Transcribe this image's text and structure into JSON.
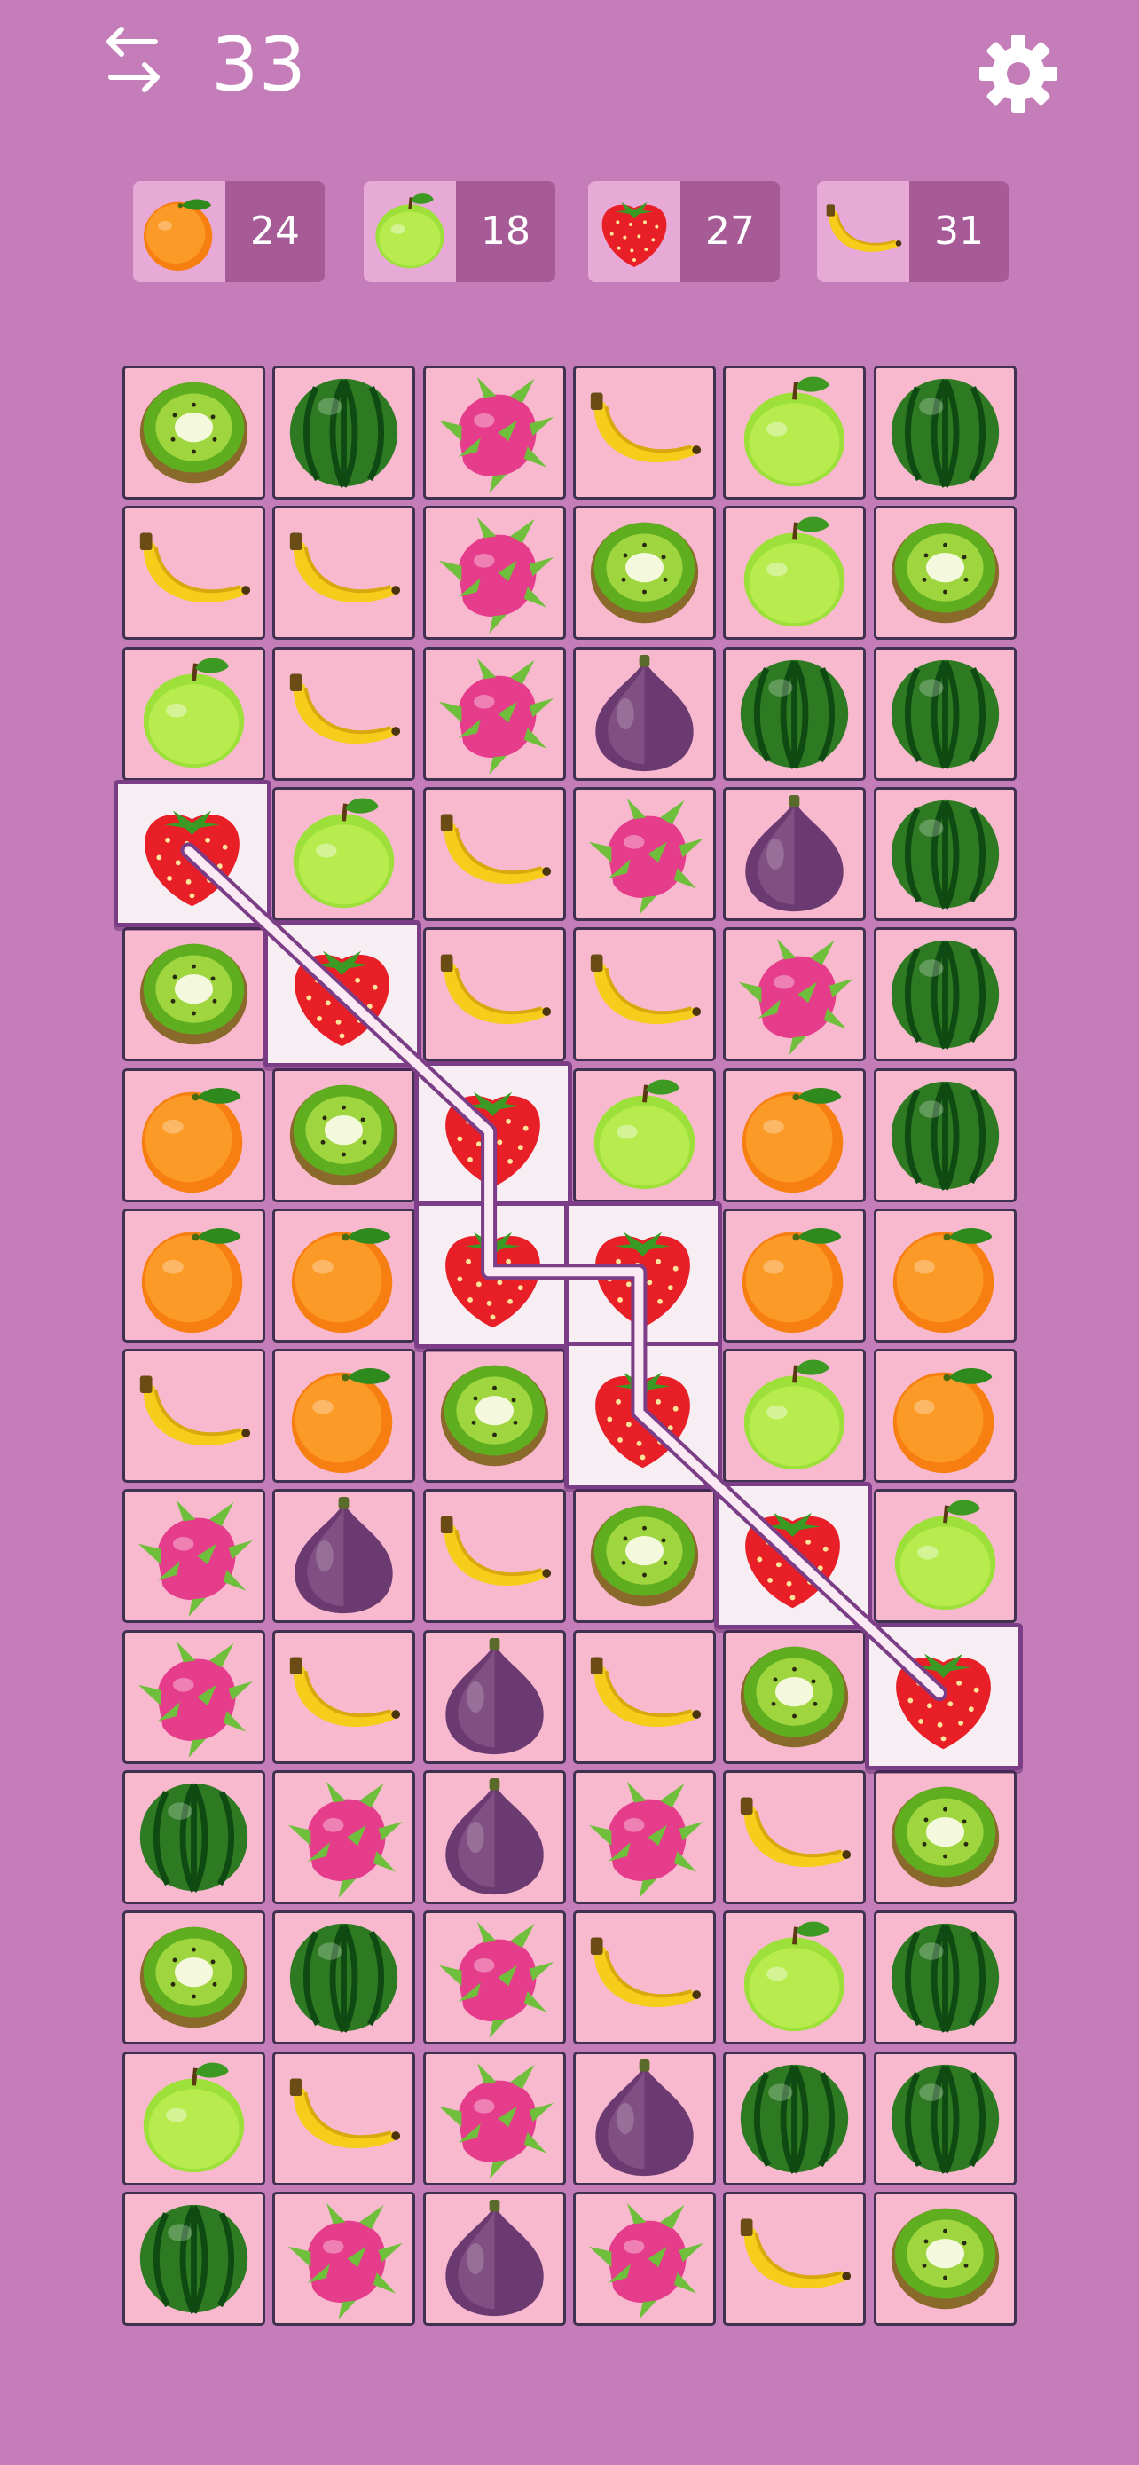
{
  "header": {
    "moves": "33"
  },
  "goals": [
    {
      "fruit": "orange",
      "count": "24"
    },
    {
      "fruit": "apple",
      "count": "18"
    },
    {
      "fruit": "strawberry",
      "count": "27"
    },
    {
      "fruit": "banana",
      "count": "31"
    }
  ],
  "icons": {
    "undo": "swap-arrows-icon",
    "settings": "gear-icon"
  },
  "colors": {
    "background": "#c47db9",
    "tile": "#f8b9cf",
    "tile_border": "#3f3150",
    "selected": "#7b3d86"
  },
  "board": {
    "columns": 6,
    "rows": 14,
    "grid": [
      [
        "kiwi",
        "watermelon",
        "dragonfruit",
        "banana",
        "apple",
        "watermelon"
      ],
      [
        "banana",
        "banana",
        "dragonfruit",
        "kiwi",
        "apple",
        "kiwi"
      ],
      [
        "apple",
        "banana",
        "dragonfruit",
        "fig",
        "watermelon",
        "watermelon"
      ],
      [
        "strawberry",
        "apple",
        "banana",
        "dragonfruit",
        "fig",
        "watermelon"
      ],
      [
        "kiwi",
        "strawberry",
        "banana",
        "banana",
        "dragonfruit",
        "watermelon"
      ],
      [
        "orange",
        "kiwi",
        "strawberry",
        "apple",
        "orange",
        "watermelon"
      ],
      [
        "orange",
        "orange",
        "strawberry",
        "strawberry",
        "orange",
        "orange"
      ],
      [
        "banana",
        "orange",
        "kiwi",
        "strawberry",
        "apple",
        "orange"
      ],
      [
        "dragonfruit",
        "fig",
        "banana",
        "kiwi",
        "strawberry",
        "apple"
      ],
      [
        "dragonfruit",
        "banana",
        "fig",
        "banana",
        "kiwi",
        "strawberry"
      ],
      [
        "watermelon",
        "dragonfruit",
        "fig",
        "dragonfruit",
        "banana",
        "kiwi"
      ],
      [
        "kiwi",
        "watermelon",
        "dragonfruit",
        "banana",
        "apple",
        "watermelon"
      ],
      [
        "apple",
        "banana",
        "dragonfruit",
        "fig",
        "watermelon",
        "watermelon"
      ],
      [
        "watermelon",
        "dragonfruit",
        "fig",
        "dragonfruit",
        "banana",
        "kiwi"
      ]
    ],
    "selected_path": [
      [
        3,
        0
      ],
      [
        4,
        1
      ],
      [
        5,
        2
      ],
      [
        6,
        2
      ],
      [
        6,
        3
      ],
      [
        7,
        3
      ],
      [
        8,
        4
      ],
      [
        9,
        5
      ]
    ]
  }
}
